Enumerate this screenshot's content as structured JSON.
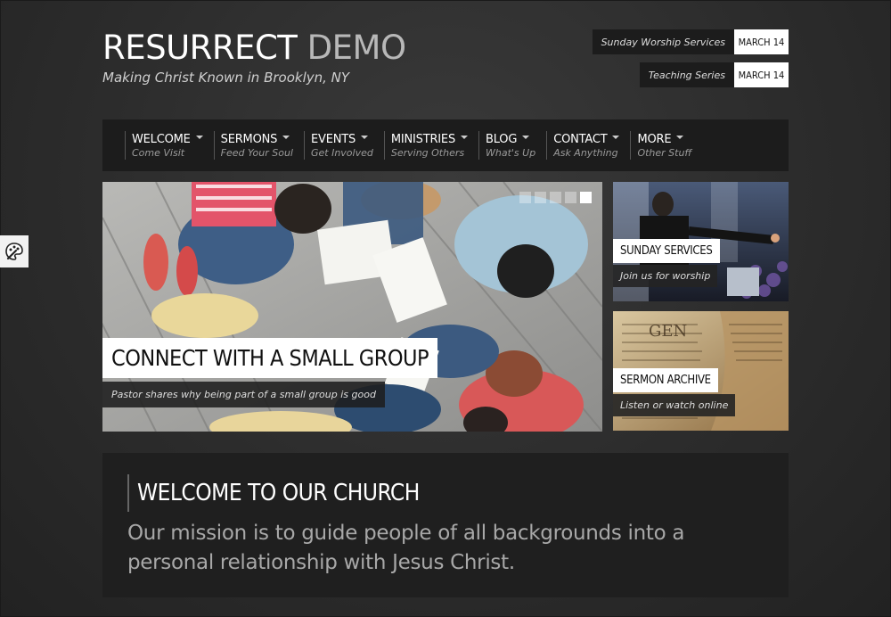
{
  "header": {
    "title_main": "RESURRECT",
    "title_accent": "DEMO",
    "tagline": "Making Christ Known in Brooklyn, NY",
    "badges": [
      {
        "label": "Sunday Worship Services",
        "date": "MARCH 14"
      },
      {
        "label": "Teaching Series",
        "date": "MARCH 14"
      }
    ]
  },
  "nav": [
    {
      "label": "WELCOME",
      "sub": "Come Visit"
    },
    {
      "label": "SERMONS",
      "sub": "Feed Your Soul"
    },
    {
      "label": "EVENTS",
      "sub": "Get Involved"
    },
    {
      "label": "MINISTRIES",
      "sub": "Serving Others"
    },
    {
      "label": "BLOG",
      "sub": "What's Up"
    },
    {
      "label": "CONTACT",
      "sub": "Ask Anything"
    },
    {
      "label": "MORE",
      "sub": "Other Stuff"
    }
  ],
  "hero": {
    "caption": "CONNECT WITH A SMALL GROUP",
    "subcaption": "Pastor shares why being part of a small group is good"
  },
  "cards": [
    {
      "title": "SUNDAY SERVICES",
      "sub": "Join us for worship"
    },
    {
      "title": "SERMON ARCHIVE",
      "sub": "Listen or watch online"
    }
  ],
  "welcome": {
    "title": "WELCOME TO OUR CHURCH",
    "text": "Our mission is to guide people of all backgrounds into a personal relationship with Jesus Christ."
  },
  "icons": {
    "tool": "palette-icon",
    "caret": "chevron-down-icon"
  },
  "colors": {
    "background": "#2c2c2c",
    "panel": "#1c1c1c",
    "accent_text": "#b8b8b8"
  }
}
